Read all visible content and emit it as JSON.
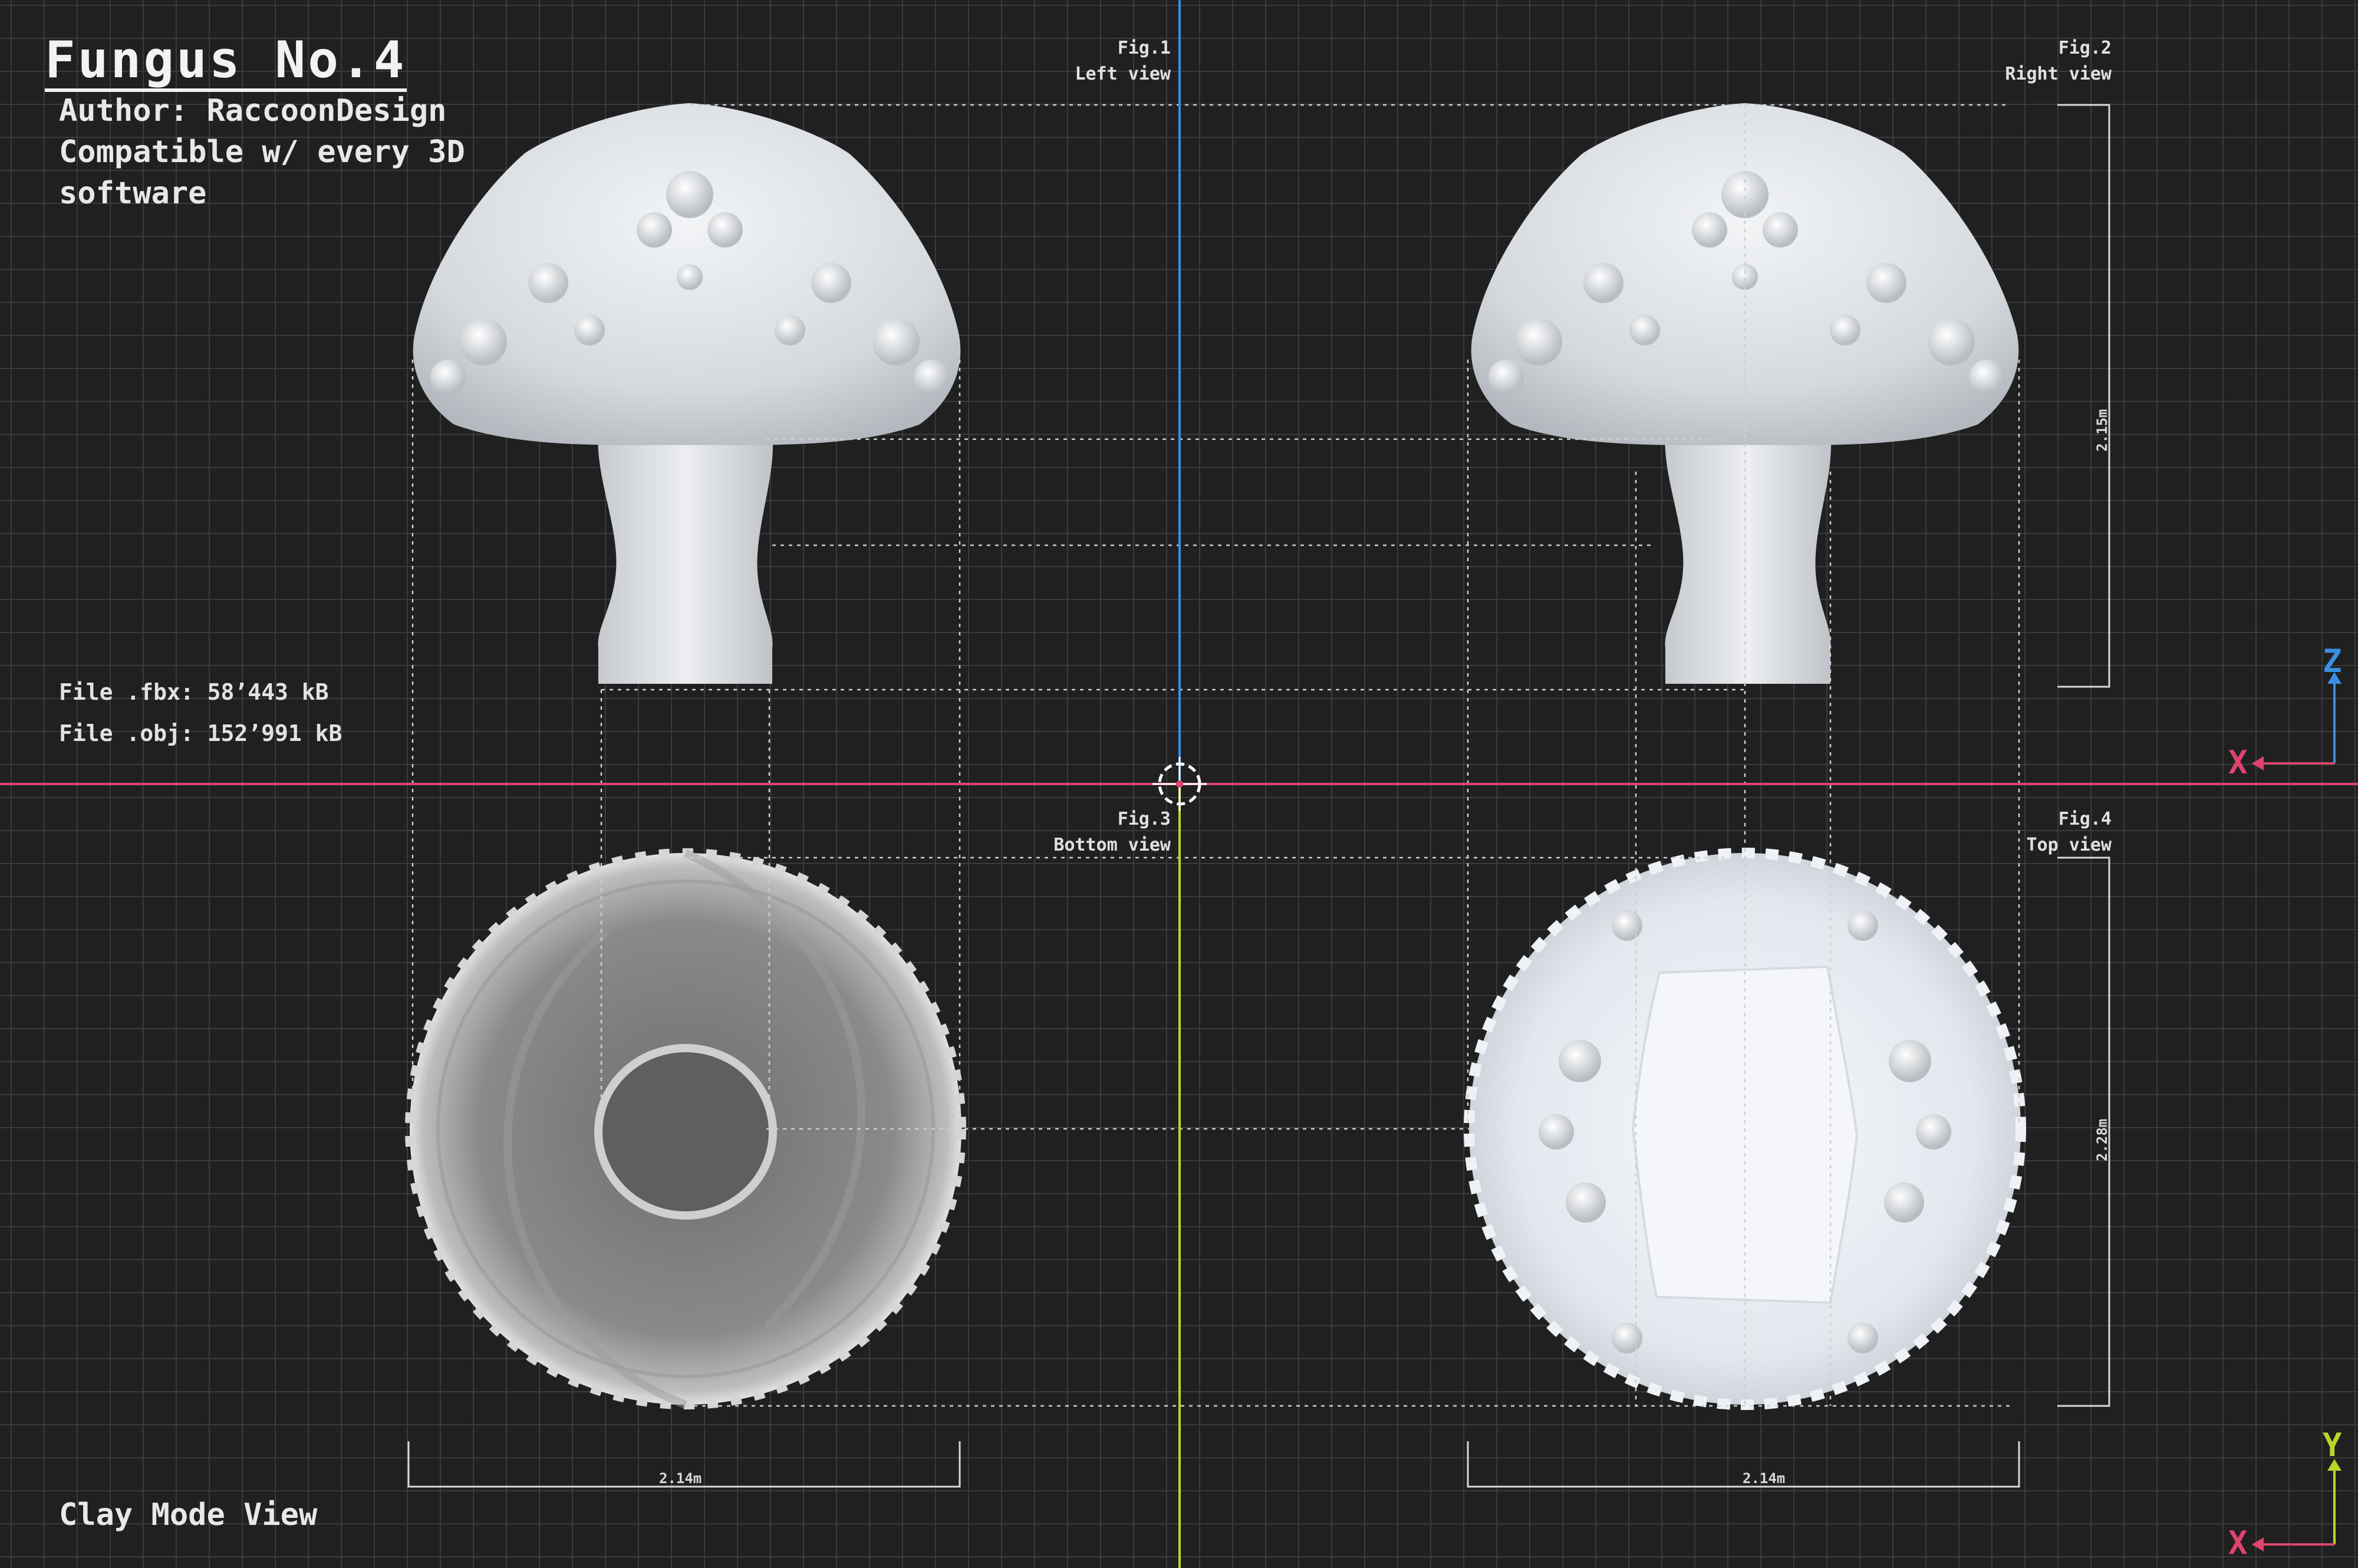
{
  "header": {
    "title": "Fungus No.4",
    "author": "Author: RaccoonDesign",
    "compat_line1": "Compatible w/ every 3D",
    "compat_line2": "software"
  },
  "files": {
    "fbx": "File .fbx: 58’443 kB",
    "obj": "File .obj: 152’991 kB"
  },
  "figures": [
    {
      "fig": "Fig.1",
      "view": "Left view"
    },
    {
      "fig": "Fig.2",
      "view": "Right view"
    },
    {
      "fig": "Fig.3",
      "view": "Bottom view"
    },
    {
      "fig": "Fig.4",
      "view": "Top view"
    }
  ],
  "dimensions": {
    "width_bottom": "2.14m",
    "width_top": "2.14m",
    "height_side": "2.15m",
    "depth_top": "2.28m"
  },
  "axes": {
    "upper": {
      "vertical": "Z",
      "horizontal": "X"
    },
    "lower": {
      "vertical": "Y",
      "horizontal": "X"
    }
  },
  "mode_label": "Clay Mode View",
  "colors": {
    "axis_x": "#e0436e",
    "axis_z": "#3a8fe0",
    "axis_y": "#b9d62a",
    "model": "#d9dde2"
  }
}
